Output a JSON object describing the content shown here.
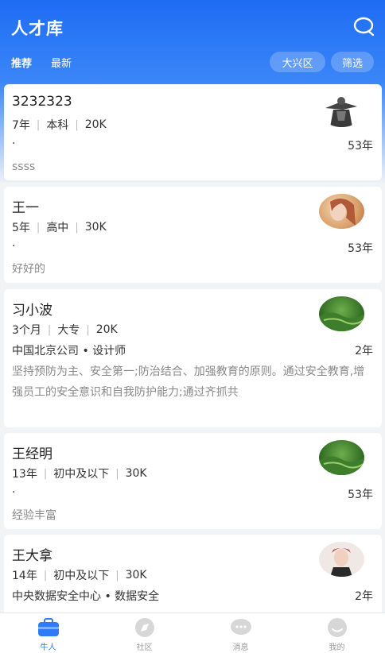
{
  "header": {
    "title": "人才库",
    "tabs": [
      {
        "label": "推荐"
      },
      {
        "label": "最新"
      }
    ],
    "region": "大兴区",
    "filter": "筛选"
  },
  "candidates": [
    {
      "name": "3232323",
      "years": "7年",
      "edu": "本科",
      "salary": "20K",
      "company": "·",
      "age": "53年",
      "desc": "ssss"
    },
    {
      "name": "王一",
      "years": "5年",
      "edu": "高中",
      "salary": "30K",
      "company": "·",
      "age": "53年",
      "desc": "好好的"
    },
    {
      "name": "习小波",
      "years": "3个月",
      "edu": "大专",
      "salary": "20K",
      "company": "中国北京公司 • 设计师",
      "age": "2年",
      "desc": "坚持预防为主、安全第一;防治结合、加强教育的原则。通过安全教育,增强员工的安全意识和自我防护能力;通过齐抓共"
    },
    {
      "name": "王经明",
      "years": "13年",
      "edu": "初中及以下",
      "salary": "30K",
      "company": "·",
      "age": "53年",
      "desc": "经验丰富"
    },
    {
      "name": "王大拿",
      "years": "14年",
      "edu": "初中及以下",
      "salary": "30K",
      "company": "中央数据安全中心 • 数据安全",
      "age": "2年",
      "desc": ""
    }
  ],
  "tabbar": [
    {
      "label": "牛人",
      "icon": "briefcase-icon"
    },
    {
      "label": "社区",
      "icon": "compass-icon"
    },
    {
      "label": "消息",
      "icon": "chat-icon"
    },
    {
      "label": "我的",
      "icon": "smile-icon"
    }
  ],
  "colors": {
    "accent": "#2d7cf6",
    "header": "#1e6cf3"
  }
}
